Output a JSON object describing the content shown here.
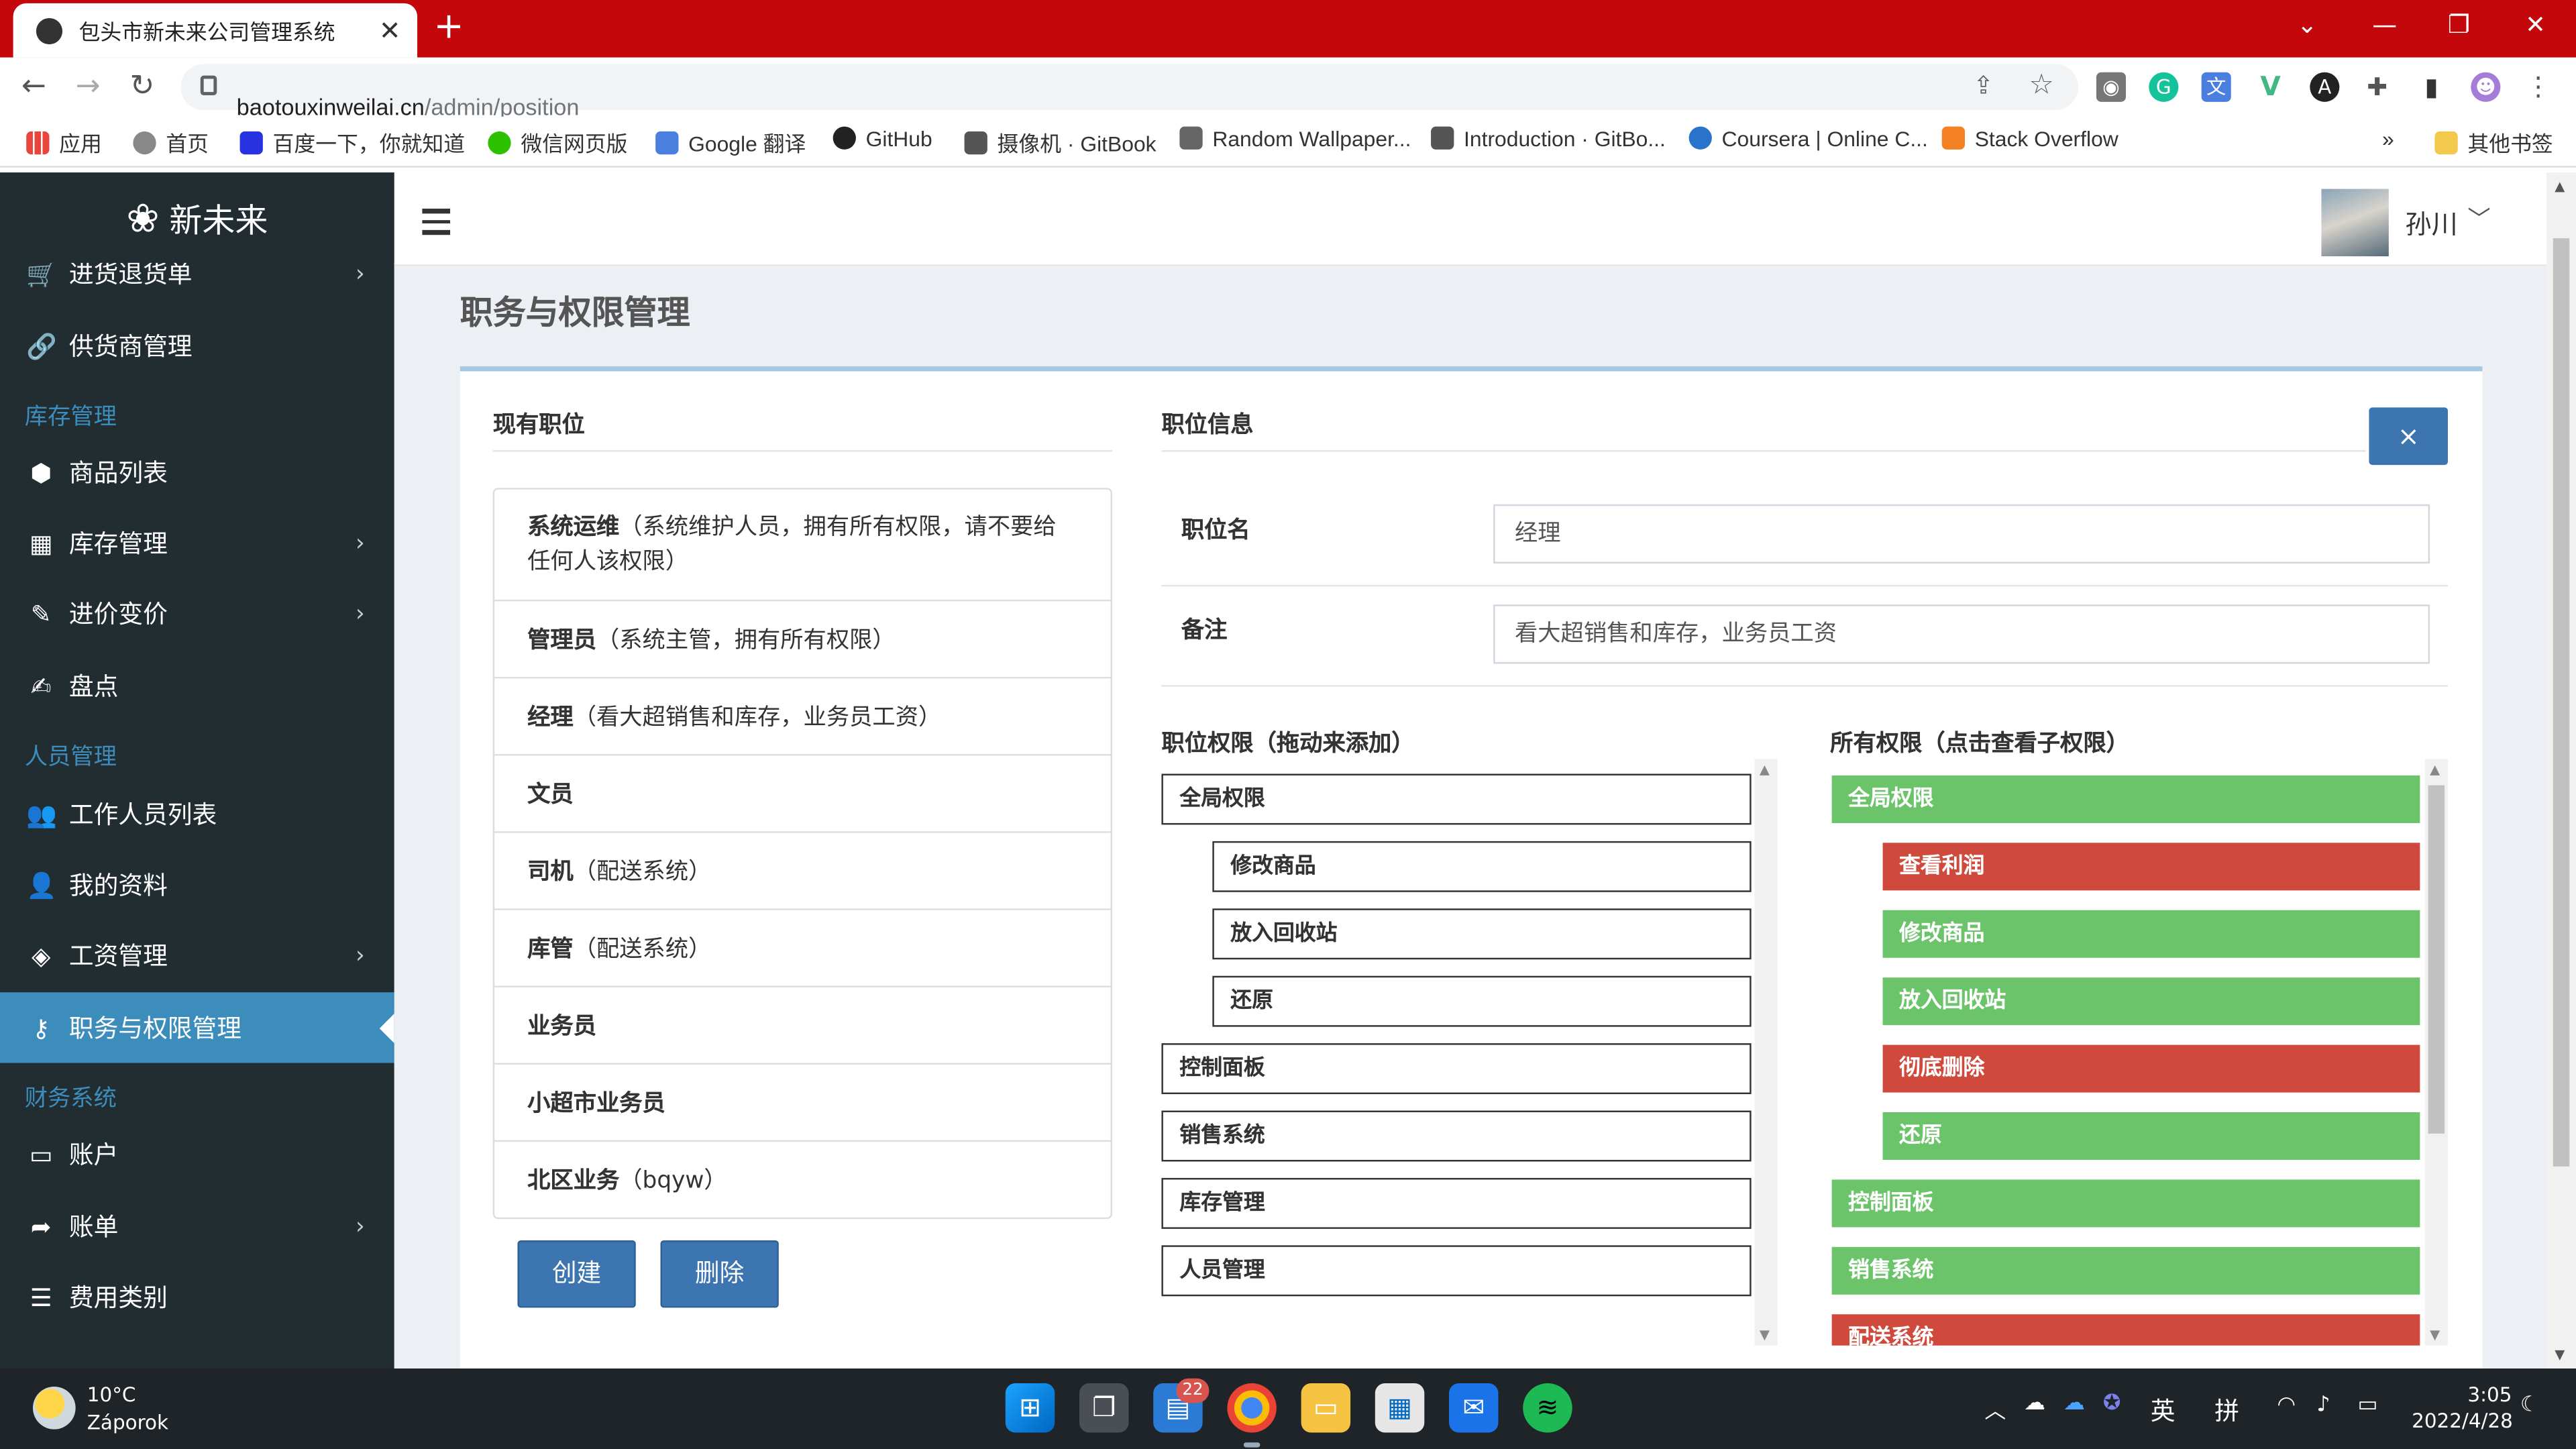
{
  "browser": {
    "tab_title": "包头市新未来公司管理系统",
    "url_host": "baotouxinweilai.cn",
    "url_path": "/admin/position",
    "extensions": [
      "camera-icon",
      "grammarly-icon",
      "translate-icon",
      "vue-icon",
      "a-icon",
      "puzzle-icon",
      "sidepanel-icon",
      "profile-icon",
      "menu-icon"
    ]
  },
  "bookmarks": {
    "items": [
      "应用",
      "首页",
      "百度一下，你就知道",
      "微信网页版",
      "Google 翻译",
      "GitHub",
      "摄像机 · GitBook",
      "Random Wallpaper...",
      "Introduction · GitBo...",
      "Coursera | Online C...",
      "Stack Overflow"
    ],
    "more": "»",
    "other": "其他书签"
  },
  "sidebar": {
    "logo": "新未来",
    "items": [
      {
        "label": "进货退货单",
        "icon": "cart-icon",
        "chevron": "›"
      },
      {
        "label": "供货商管理",
        "icon": "link-icon"
      },
      {
        "label": "库存管理",
        "header": true
      },
      {
        "label": "商品列表",
        "icon": "cubes-icon"
      },
      {
        "label": "库存管理",
        "icon": "grid-icon",
        "chevron": "›"
      },
      {
        "label": "进价变价",
        "icon": "edit-icon",
        "chevron": "›"
      },
      {
        "label": "盘点",
        "icon": "pencil-square-icon"
      },
      {
        "label": "人员管理",
        "header": true
      },
      {
        "label": "工作人员列表",
        "icon": "users-icon"
      },
      {
        "label": "我的资料",
        "icon": "user-icon"
      },
      {
        "label": "工资管理",
        "icon": "tag-icon",
        "chevron": "›"
      },
      {
        "label": "职务与权限管理",
        "icon": "key-icon",
        "active": true
      },
      {
        "label": "财务系统",
        "header": true
      },
      {
        "label": "账户",
        "icon": "credit-card-icon"
      },
      {
        "label": "账单",
        "icon": "share-icon",
        "chevron": "›"
      },
      {
        "label": "费用类别",
        "icon": "list-icon"
      }
    ]
  },
  "header": {
    "user_name": "孙川",
    "chevron": "﹀"
  },
  "page": {
    "title": "职务与权限管理",
    "positions_heading": "现有职位",
    "positions": [
      {
        "name": "系统运维",
        "note": "（系统维护人员，拥有所有权限，请不要给任何人该权限）"
      },
      {
        "name": "管理员",
        "note": "（系统主管，拥有所有权限）"
      },
      {
        "name": "经理",
        "note": "（看大超销售和库存，业务员工资）"
      },
      {
        "name": "文员",
        "note": ""
      },
      {
        "name": "司机",
        "note": "（配送系统）"
      },
      {
        "name": "库管",
        "note": "（配送系统）"
      },
      {
        "name": "业务员",
        "note": ""
      },
      {
        "name": "小超市业务员",
        "note": ""
      },
      {
        "name": "北区业务",
        "note": "（bqyw）"
      }
    ],
    "create_button": "创建",
    "delete_button": "删除",
    "info_heading": "职位信息",
    "close_label": "×",
    "fields": {
      "name_label": "职位名",
      "name_value": "经理",
      "note_label": "备注",
      "note_value": "看大超销售和库存，业务员工资"
    },
    "position_perms_heading": "职位权限（拖动来添加）",
    "position_perms": [
      {
        "label": "全局权限",
        "indent": 0
      },
      {
        "label": "修改商品",
        "indent": 1
      },
      {
        "label": "放入回收站",
        "indent": 1
      },
      {
        "label": "还原",
        "indent": 1
      },
      {
        "label": "控制面板",
        "indent": 0
      },
      {
        "label": "销售系统",
        "indent": 0
      },
      {
        "label": "库存管理",
        "indent": 0
      },
      {
        "label": "人员管理",
        "indent": 0
      }
    ],
    "all_perms_heading": "所有权限（点击查看子权限）",
    "all_perms": [
      {
        "label": "全局权限",
        "indent": 0,
        "color": "#6cc46a"
      },
      {
        "label": "查看利润",
        "indent": 1,
        "color": "#cf4a3c"
      },
      {
        "label": "修改商品",
        "indent": 1,
        "color": "#6cc46a"
      },
      {
        "label": "放入回收站",
        "indent": 1,
        "color": "#6cc46a"
      },
      {
        "label": "彻底删除",
        "indent": 1,
        "color": "#cf4a3c"
      },
      {
        "label": "还原",
        "indent": 1,
        "color": "#6cc46a"
      },
      {
        "label": "控制面板",
        "indent": 0,
        "color": "#6cc46a"
      },
      {
        "label": "销售系统",
        "indent": 0,
        "color": "#6cc46a"
      },
      {
        "label": "配送系统",
        "indent": 0,
        "color": "#cf4a3c"
      }
    ]
  },
  "taskbar": {
    "weather_temp": "10°C",
    "weather_desc": "Záporok",
    "badge_count": "22",
    "ime_lang": "英",
    "ime_mode": "拼",
    "time": "3:05",
    "date": "2022/4/28"
  },
  "colors": {
    "chrome_tab_bar": "#c3070b",
    "sidebar_bg": "#222d32",
    "accent": "#3c8dbc",
    "button": "#3c75b0",
    "granted": "#6cc46a",
    "denied": "#cf4a3c"
  }
}
